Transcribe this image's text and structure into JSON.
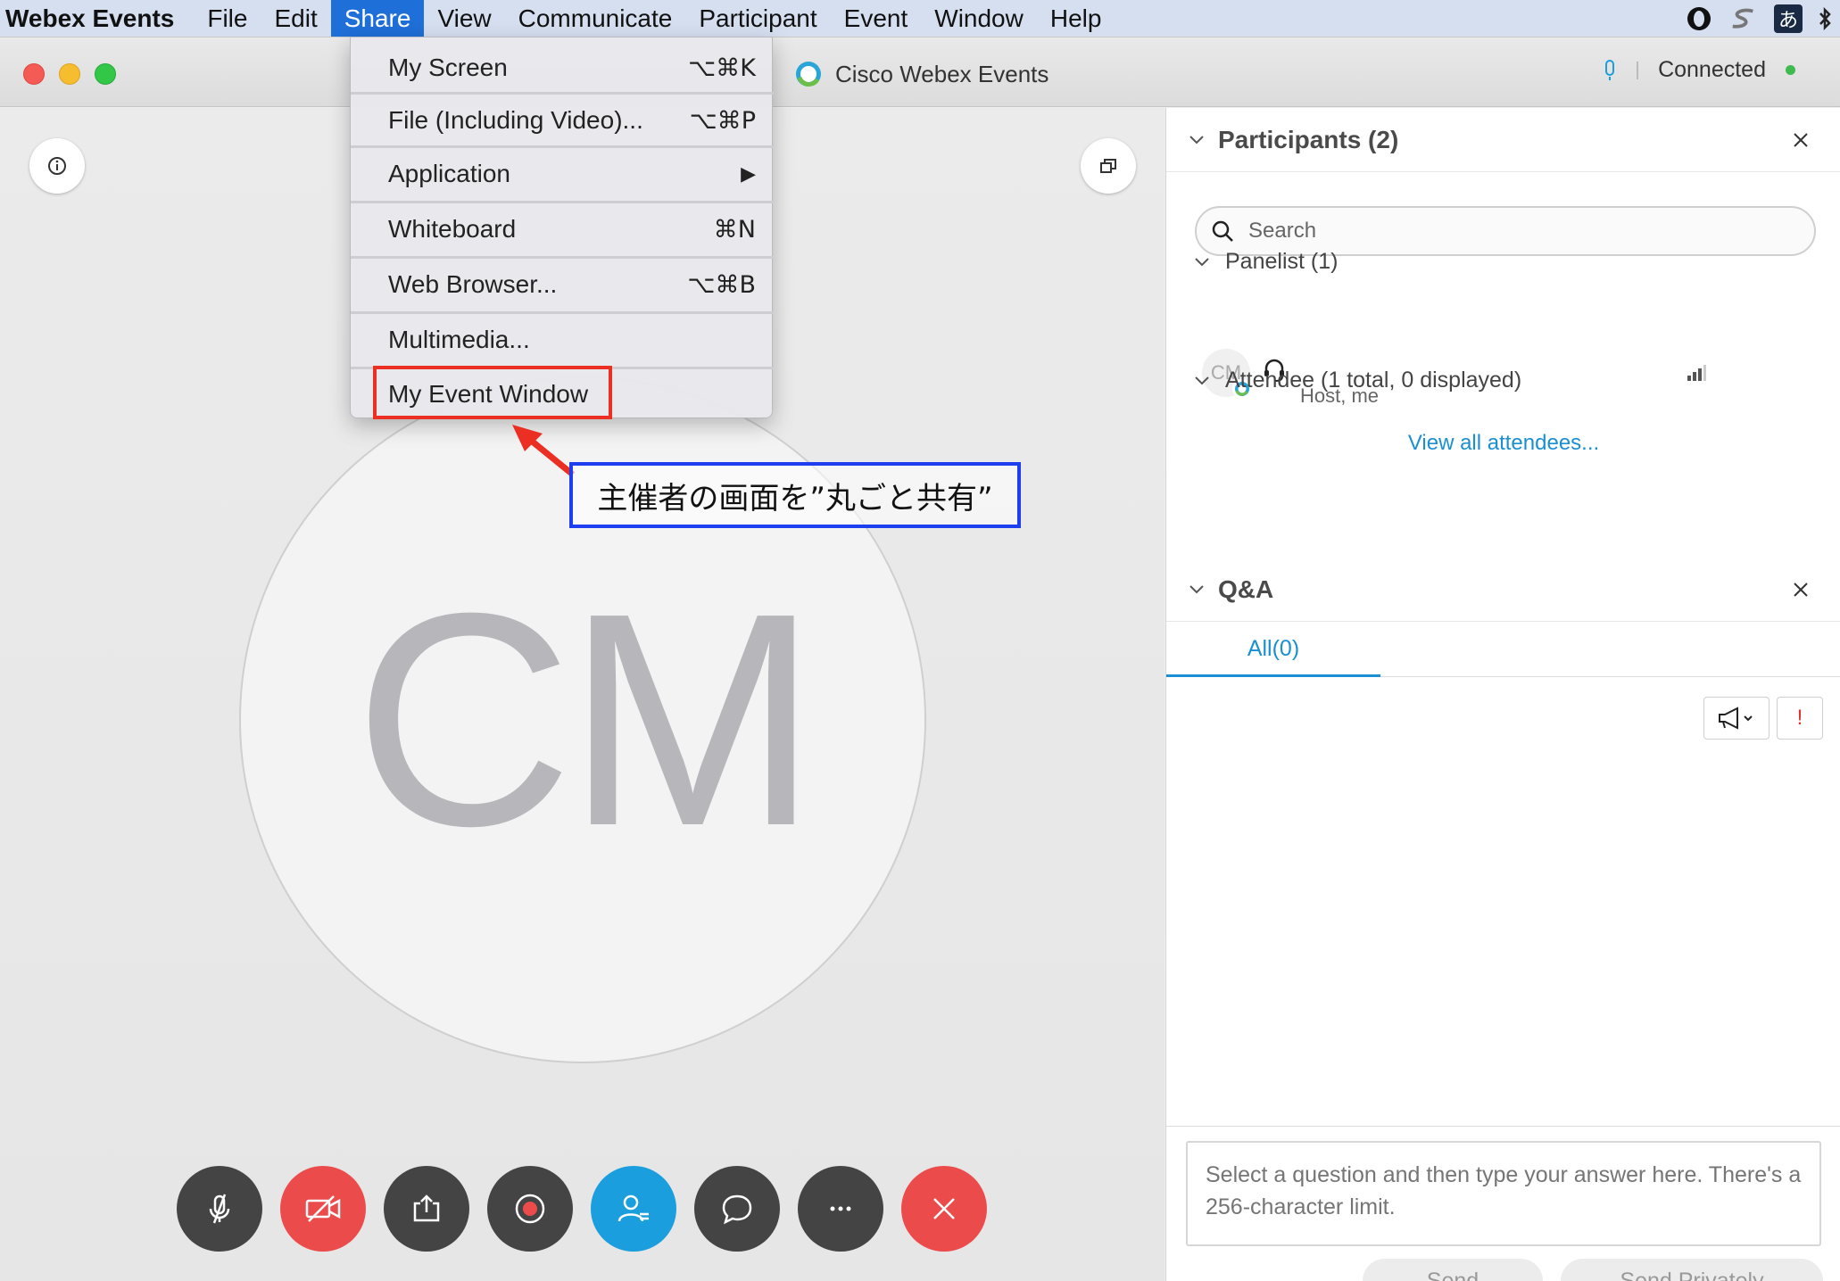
{
  "menubar": {
    "app_name": "Webex Events",
    "items": [
      "File",
      "Edit",
      "Share",
      "View",
      "Communicate",
      "Participant",
      "Event",
      "Window",
      "Help"
    ],
    "active": "Share",
    "ime": "あ"
  },
  "window": {
    "title": "Cisco Webex Events",
    "status": "Connected",
    "status_color": "#3dbb4f"
  },
  "share_menu": {
    "items": [
      {
        "label": "My Screen",
        "shortcut": "⌥⌘K"
      },
      {
        "label": "File (Including Video)...",
        "shortcut": "⌥⌘P"
      },
      {
        "label": "Application",
        "shortcut": "▶"
      },
      {
        "label": "Whiteboard",
        "shortcut": "⌘N"
      },
      {
        "label": "Web Browser...",
        "shortcut": "⌥⌘B"
      },
      {
        "label": "Multimedia...",
        "shortcut": ""
      },
      {
        "label": "My Event Window",
        "shortcut": ""
      }
    ],
    "highlighted": "My Event Window"
  },
  "annotation": {
    "text": "主催者の画面を”丸ごと共有”",
    "box_color": "#1e3ff0",
    "highlight_color": "#ec2f23"
  },
  "stage": {
    "avatar_initials": "CM"
  },
  "controls": [
    "mute-microphone",
    "stop-video",
    "share",
    "record",
    "participants",
    "chat",
    "more-options",
    "leave-event"
  ],
  "participants": {
    "title": "Participants (2)",
    "search_placeholder": "Search",
    "panelist_section": "Panelist (1)",
    "panelist": {
      "initials": "CM",
      "role": "Host, me"
    },
    "attendee_section": "Attendee (1 total, 0 displayed)",
    "view_all": "View all attendees...",
    "alert_glyph": "!"
  },
  "qa": {
    "title": "Q&A",
    "tab_all": "All(0)",
    "answer_placeholder": "Select a question and then type your answer here. There's a 256-character limit.",
    "send": "Send",
    "send_privately": "Send Privately"
  },
  "colors": {
    "accent": "#1a9ede",
    "danger": "#ec4b4b",
    "menu_highlight": "#1f6fd8"
  }
}
